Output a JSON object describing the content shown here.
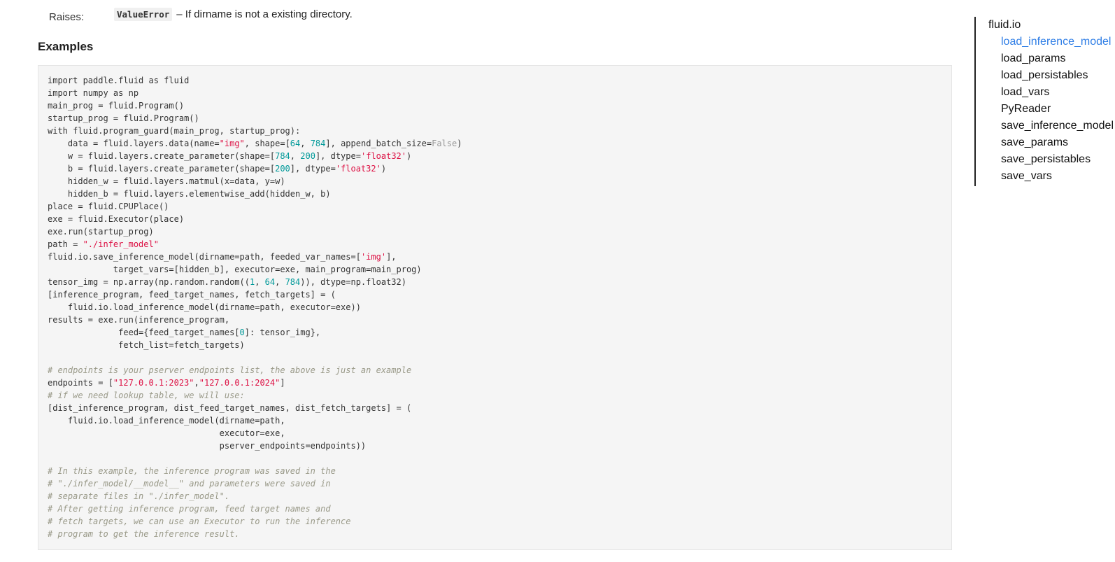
{
  "raises": {
    "label": "Raises:",
    "exception": "ValueError",
    "description": "– If dirname is not a existing directory."
  },
  "examples": {
    "heading": "Examples"
  },
  "code": {
    "lines": [
      [
        {
          "t": "import paddle.fluid as fluid"
        }
      ],
      [
        {
          "t": "import numpy as np"
        }
      ],
      [
        {
          "t": "main_prog = fluid.Program()"
        }
      ],
      [
        {
          "t": "startup_prog = fluid.Program()"
        }
      ],
      [
        {
          "t": "with fluid.program_guard(main_prog, startup_prog):"
        }
      ],
      [
        {
          "t": "    data = fluid.layers.data(name="
        },
        {
          "t": "\"img\"",
          "c": "str"
        },
        {
          "t": ", shape=["
        },
        {
          "t": "64",
          "c": "num"
        },
        {
          "t": ", "
        },
        {
          "t": "784",
          "c": "num"
        },
        {
          "t": "], append_batch_size="
        },
        {
          "t": "False",
          "c": "kw"
        },
        {
          "t": ")"
        }
      ],
      [
        {
          "t": "    w = fluid.layers.create_parameter(shape=["
        },
        {
          "t": "784",
          "c": "num"
        },
        {
          "t": ", "
        },
        {
          "t": "200",
          "c": "num"
        },
        {
          "t": "], dtype="
        },
        {
          "t": "'float32'",
          "c": "str"
        },
        {
          "t": ")"
        }
      ],
      [
        {
          "t": "    b = fluid.layers.create_parameter(shape=["
        },
        {
          "t": "200",
          "c": "num"
        },
        {
          "t": "], dtype="
        },
        {
          "t": "'float32'",
          "c": "str"
        },
        {
          "t": ")"
        }
      ],
      [
        {
          "t": "    hidden_w = fluid.layers.matmul(x=data, y=w)"
        }
      ],
      [
        {
          "t": "    hidden_b = fluid.layers.elementwise_add(hidden_w, b)"
        }
      ],
      [
        {
          "t": "place = fluid.CPUPlace()"
        }
      ],
      [
        {
          "t": "exe = fluid.Executor(place)"
        }
      ],
      [
        {
          "t": "exe.run(startup_prog)"
        }
      ],
      [
        {
          "t": "path = "
        },
        {
          "t": "\"./infer_model\"",
          "c": "str"
        }
      ],
      [
        {
          "t": "fluid.io.save_inference_model(dirname=path, feeded_var_names=["
        },
        {
          "t": "'img'",
          "c": "str"
        },
        {
          "t": "],"
        }
      ],
      [
        {
          "t": "             target_vars=[hidden_b], executor=exe, main_program=main_prog)"
        }
      ],
      [
        {
          "t": "tensor_img = np.array(np.random.random(("
        },
        {
          "t": "1",
          "c": "num"
        },
        {
          "t": ", "
        },
        {
          "t": "64",
          "c": "num"
        },
        {
          "t": ", "
        },
        {
          "t": "784",
          "c": "num"
        },
        {
          "t": ")), dtype=np.float32)"
        }
      ],
      [
        {
          "t": "[inference_program, feed_target_names, fetch_targets] = ("
        }
      ],
      [
        {
          "t": "    fluid.io.load_inference_model(dirname=path, executor=exe))"
        }
      ],
      [
        {
          "t": "results = exe.run(inference_program,"
        }
      ],
      [
        {
          "t": "              feed={feed_target_names["
        },
        {
          "t": "0",
          "c": "num"
        },
        {
          "t": "]: tensor_img},"
        }
      ],
      [
        {
          "t": "              fetch_list=fetch_targets)"
        }
      ],
      [
        {
          "t": ""
        }
      ],
      [
        {
          "t": "# endpoints is your pserver endpoints list, the above is just an example",
          "c": "com"
        }
      ],
      [
        {
          "t": "endpoints = ["
        },
        {
          "t": "\"127.0.0.1:2023\"",
          "c": "str"
        },
        {
          "t": ","
        },
        {
          "t": "\"127.0.0.1:2024\"",
          "c": "str"
        },
        {
          "t": "]"
        }
      ],
      [
        {
          "t": "# if we need lookup table, we will use:",
          "c": "com"
        }
      ],
      [
        {
          "t": "[dist_inference_program, dist_feed_target_names, dist_fetch_targets] = ("
        }
      ],
      [
        {
          "t": "    fluid.io.load_inference_model(dirname=path,"
        }
      ],
      [
        {
          "t": "                                  executor=exe,"
        }
      ],
      [
        {
          "t": "                                  pserver_endpoints=endpoints))"
        }
      ],
      [
        {
          "t": ""
        }
      ],
      [
        {
          "t": "# In this example, the inference program was saved in the",
          "c": "com"
        }
      ],
      [
        {
          "t": "# \"./infer_model/__model__\" and parameters were saved in",
          "c": "com"
        }
      ],
      [
        {
          "t": "# separate files in \"./infer_model\".",
          "c": "com"
        }
      ],
      [
        {
          "t": "# After getting inference program, feed target names and",
          "c": "com"
        }
      ],
      [
        {
          "t": "# fetch targets, we can use an Executor to run the inference",
          "c": "com"
        }
      ],
      [
        {
          "t": "# program to get the inference result.",
          "c": "com"
        }
      ]
    ]
  },
  "toc": {
    "root": "fluid.io",
    "items": [
      {
        "label": "load_inference_model",
        "active": true
      },
      {
        "label": "load_params",
        "active": false
      },
      {
        "label": "load_persistables",
        "active": false
      },
      {
        "label": "load_vars",
        "active": false
      },
      {
        "label": "PyReader",
        "active": false
      },
      {
        "label": "save_inference_model",
        "active": false
      },
      {
        "label": "save_params",
        "active": false
      },
      {
        "label": "save_persistables",
        "active": false
      },
      {
        "label": "save_vars",
        "active": false
      }
    ]
  },
  "colors": {
    "active_link": "#2f7ee6",
    "string": "#d14",
    "number": "#009999",
    "keyword": "#999999",
    "comment": "#999988",
    "code_bg": "#f5f5f5"
  }
}
